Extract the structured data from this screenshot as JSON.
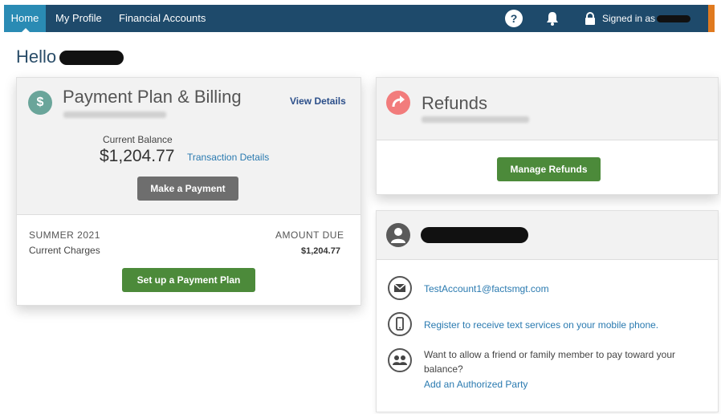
{
  "nav": {
    "home": "Home",
    "profile": "My Profile",
    "financial": "Financial Accounts",
    "help_glyph": "?",
    "signed_in": "Signed in as"
  },
  "greeting": "Hello",
  "payment_card": {
    "title": "Payment Plan & Billing",
    "view_details": "View Details",
    "balance_label": "Current Balance",
    "balance": "$1,204.77",
    "transaction_details": "Transaction Details",
    "make_payment": "Make a Payment",
    "term": "SUMMER 2021",
    "charges_label": "Current Charges",
    "amount_due_label": "AMOUNT DUE",
    "amount_due": "$1,204.77",
    "setup_plan": "Set up a Payment Plan"
  },
  "refunds_card": {
    "title": "Refunds",
    "manage": "Manage Refunds"
  },
  "account_card": {
    "email": "TestAccount1@factsmgt.com",
    "register_text": "Register to receive text services on your mobile phone.",
    "authorize_question": "Want to allow a friend or family member to pay toward your balance?",
    "authorize_link": "Add an Authorized Party"
  },
  "colors": {
    "nav_bg": "#1e4a6b",
    "nav_active": "#2a8bb4",
    "button_green": "#4c8a3a",
    "button_gray": "#6e6e6e",
    "link_blue": "#2a7ab0",
    "accent_orange": "#e07a1f"
  },
  "icons": {
    "help": "help-icon",
    "notifications": "bell-icon",
    "lock": "lock-icon",
    "payment": "dollar-icon",
    "refund": "refund-arrow-icon",
    "user": "user-icon",
    "email": "envelope-icon",
    "phone": "mobile-phone-icon",
    "people": "people-icon"
  }
}
